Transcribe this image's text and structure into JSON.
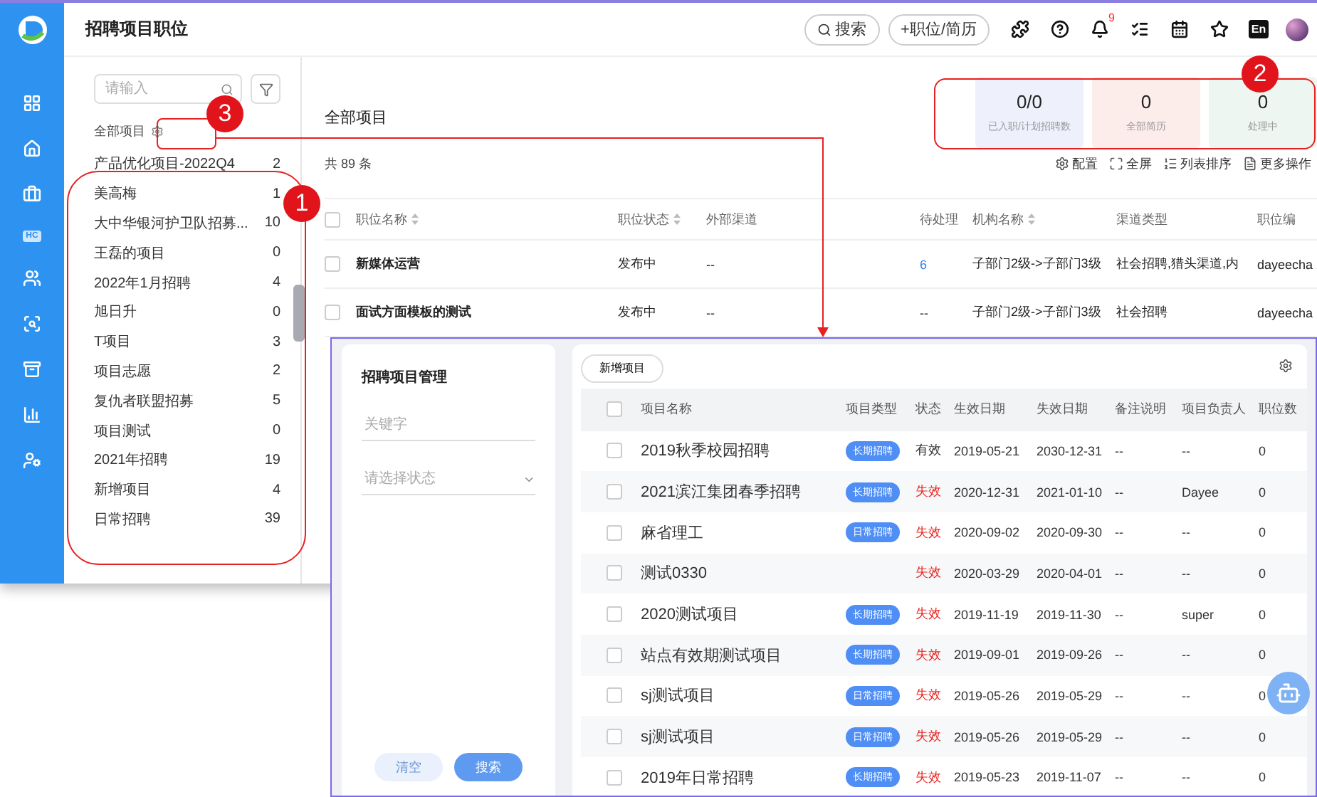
{
  "header": {
    "title": "招聘项目职位",
    "search_button": "搜索",
    "add_button": "+职位/简历",
    "tools": [
      {
        "kind": "puzzle"
      },
      {
        "kind": "help"
      },
      {
        "kind": "bell",
        "badge": "9"
      },
      {
        "kind": "checklist"
      },
      {
        "kind": "calendar"
      },
      {
        "kind": "star-folder"
      },
      {
        "kind": "language",
        "label": "En"
      },
      {
        "kind": "avatar"
      }
    ]
  },
  "rail": [
    {
      "kind": "grid"
    },
    {
      "kind": "home"
    },
    {
      "kind": "briefcase"
    },
    {
      "kind": "text",
      "label": "HC"
    },
    {
      "kind": "people"
    },
    {
      "kind": "search-box"
    },
    {
      "kind": "archive"
    },
    {
      "kind": "chart"
    },
    {
      "kind": "user-settings"
    }
  ],
  "project_list": {
    "search": {
      "placeholder": "请输入"
    },
    "all_label": "全部项目",
    "items": [
      {
        "name": "产品优化项目-2022Q4",
        "count": "2"
      },
      {
        "name": "美高梅",
        "count": "1"
      },
      {
        "name": "大中华银河护卫队招募...",
        "count": "10"
      },
      {
        "name": "王磊的项目",
        "count": "0"
      },
      {
        "name": "2022年1月招聘",
        "count": "4"
      },
      {
        "name": "旭日升",
        "count": "0"
      },
      {
        "name": "T项目",
        "count": "3"
      },
      {
        "name": "项目志愿",
        "count": "2"
      },
      {
        "name": "复仇者联盟招募",
        "count": "5"
      },
      {
        "name": "项目测试",
        "count": "0"
      },
      {
        "name": "2021年招聘",
        "count": "19"
      },
      {
        "name": "新增项目",
        "count": "4"
      },
      {
        "name": "日常招聘",
        "count": "39"
      }
    ]
  },
  "main": {
    "title": "全部项目",
    "stats": [
      {
        "value": "0/0",
        "label": "已入职/计划招聘数",
        "color": "#eef0fc"
      },
      {
        "value": "0",
        "label": "全部简历",
        "color": "#fcecea"
      },
      {
        "value": "0",
        "label": "处理中",
        "color": "#edf6f1"
      }
    ],
    "total": "共 89 条",
    "toolbar": [
      {
        "kind": "config",
        "label": "配置"
      },
      {
        "kind": "fullscreen",
        "label": "全屏"
      },
      {
        "kind": "sort",
        "label": "列表排序"
      },
      {
        "kind": "more",
        "label": "更多操作"
      }
    ],
    "table": {
      "columns": [
        {
          "label": "职位名称",
          "sortable": true
        },
        {
          "label": "职位状态",
          "sortable": true
        },
        {
          "label": "外部渠道",
          "sortable": false
        },
        {
          "label": "待处理",
          "sortable": false
        },
        {
          "label": "机构名称",
          "sortable": true
        },
        {
          "label": "渠道类型",
          "sortable": false
        },
        {
          "label": "职位编",
          "sortable": false
        }
      ],
      "all_checked": false,
      "rows": [
        {
          "cells": [
            "新媒体运营",
            "发布中",
            "--",
            "6",
            "子部门2级->子部门3级",
            "社会招聘,猎头渠道,内",
            "dayeecha"
          ],
          "pending_link": true,
          "checked": false
        },
        {
          "cells": [
            "面试方面模板的测试",
            "发布中",
            "--",
            "--",
            "子部门2级->子部门3级",
            "社会招聘",
            "dayeecha"
          ],
          "pending_link": false,
          "checked": false
        }
      ]
    }
  },
  "overlay": {
    "filter": {
      "title": "招聘项目管理",
      "keyword": {
        "placeholder": "关键字"
      },
      "status_select": {
        "placeholder": "请选择状态"
      },
      "clear_button": "清空",
      "search_button": "搜索"
    },
    "add_button": "新增项目",
    "all_checked": false,
    "columns": [
      "项目名称",
      "项目类型",
      "状态",
      "生效日期",
      "失效日期",
      "备注说明",
      "项目负责人",
      "职位数"
    ],
    "rows": [
      {
        "checked": false,
        "name": "2019秋季校园招聘",
        "type": "长期招聘",
        "status": "有效",
        "valid": true,
        "start": "2019-05-21",
        "end": "2030-12-31",
        "note": "--",
        "owner": "--",
        "count": "0"
      },
      {
        "checked": false,
        "name": "2021滨江集团春季招聘",
        "type": "长期招聘",
        "status": "失效",
        "valid": false,
        "start": "2020-12-31",
        "end": "2021-01-10",
        "note": "--",
        "owner": "Dayee",
        "count": "0"
      },
      {
        "checked": false,
        "name": "麻省理工",
        "type": "日常招聘",
        "status": "失效",
        "valid": false,
        "start": "2020-09-02",
        "end": "2020-09-30",
        "note": "--",
        "owner": "--",
        "count": "0"
      },
      {
        "checked": false,
        "name": "测试0330",
        "status": "失效",
        "valid": false,
        "start": "2020-03-29",
        "end": "2020-04-01",
        "note": "--",
        "owner": "--",
        "count": "0"
      },
      {
        "checked": false,
        "name": "2020测试项目",
        "type": "长期招聘",
        "status": "失效",
        "valid": false,
        "start": "2019-11-19",
        "end": "2019-11-30",
        "note": "--",
        "owner": "super",
        "count": "0"
      },
      {
        "checked": false,
        "name": "站点有效期测试项目",
        "type": "长期招聘",
        "status": "失效",
        "valid": false,
        "start": "2019-09-01",
        "end": "2019-09-26",
        "note": "--",
        "owner": "--",
        "count": "0"
      },
      {
        "checked": false,
        "name": "sj测试项目",
        "type": "日常招聘",
        "status": "失效",
        "valid": false,
        "start": "2019-05-26",
        "end": "2019-05-29",
        "note": "--",
        "owner": "--",
        "count": "0"
      },
      {
        "checked": false,
        "name": "sj测试项目",
        "type": "日常招聘",
        "status": "失效",
        "valid": false,
        "start": "2019-05-26",
        "end": "2019-05-29",
        "note": "--",
        "owner": "--",
        "count": "0"
      },
      {
        "checked": false,
        "name": "2019年日常招聘",
        "type": "长期招聘",
        "status": "失效",
        "valid": false,
        "start": "2019-05-23",
        "end": "2019-11-07",
        "note": "--",
        "owner": "--",
        "count": "0"
      }
    ]
  },
  "annotations": [
    {
      "label": "1"
    },
    {
      "label": "2"
    },
    {
      "label": "3"
    }
  ]
}
